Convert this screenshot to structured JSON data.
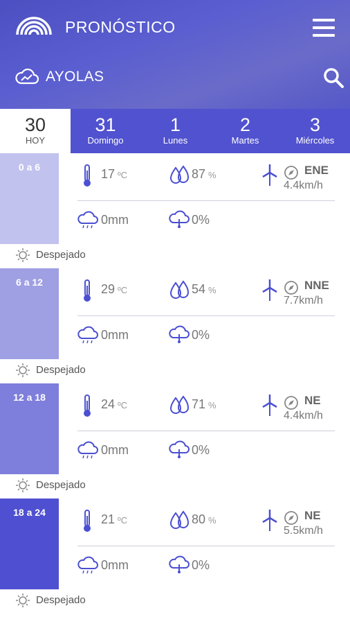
{
  "header": {
    "title": "PRONÓSTICO",
    "logo_icon": "rainbow-logo-icon",
    "menu_icon": "hamburger-menu-icon",
    "location": "AYOLAS",
    "location_icon": "cloud-chart-icon",
    "search_icon": "search-icon",
    "gradient_color": "#5558c8"
  },
  "tabs": [
    {
      "num": "30",
      "day": "HOY",
      "active": true
    },
    {
      "num": "31",
      "day": "Domingo",
      "active": false
    },
    {
      "num": "1",
      "day": "Lunes",
      "active": false
    },
    {
      "num": "2",
      "day": "Martes",
      "active": false
    },
    {
      "num": "3",
      "day": "Miércoles",
      "active": false
    }
  ],
  "periods": [
    {
      "range": "0 a 6",
      "temp": "17",
      "temp_unit": "ºC",
      "humidity": "87",
      "humidity_unit": "%",
      "wind_dir": "ENE",
      "wind_speed": "4.4km/h",
      "rain": "0mm",
      "rain_prob": "0%",
      "condition": "Despejado",
      "band_color": "#c2c2ef"
    },
    {
      "range": "6 a 12",
      "temp": "29",
      "temp_unit": "ºC",
      "humidity": "54",
      "humidity_unit": "%",
      "wind_dir": "NNE",
      "wind_speed": "7.7km/h",
      "rain": "0mm",
      "rain_prob": "0%",
      "condition": "Despejado",
      "band_color": "#9f9fe3"
    },
    {
      "range": "12 a 18",
      "temp": "24",
      "temp_unit": "ºC",
      "humidity": "71",
      "humidity_unit": "%",
      "wind_dir": "NE",
      "wind_speed": "4.4km/h",
      "rain": "0mm",
      "rain_prob": "0%",
      "condition": "Despejado",
      "band_color": "#7e7edc"
    },
    {
      "range": "18 a 24",
      "temp": "21",
      "temp_unit": "ºC",
      "humidity": "80",
      "humidity_unit": "%",
      "wind_dir": "NE",
      "wind_speed": "5.5km/h",
      "rain": "0mm",
      "rain_prob": "0%",
      "condition": "Despejado",
      "band_color": "#4f4fd1"
    }
  ],
  "icons": {
    "temperature": "thermometer-icon",
    "humidity": "drops-icon",
    "wind": "wind-turbine-icon",
    "compass": "compass-icon",
    "rain": "rain-cloud-icon",
    "rain_prob": "cloud-probability-icon",
    "condition": "sun-icon"
  },
  "colors": {
    "accent": "#5152cf",
    "icon": "#4b4fd1"
  }
}
